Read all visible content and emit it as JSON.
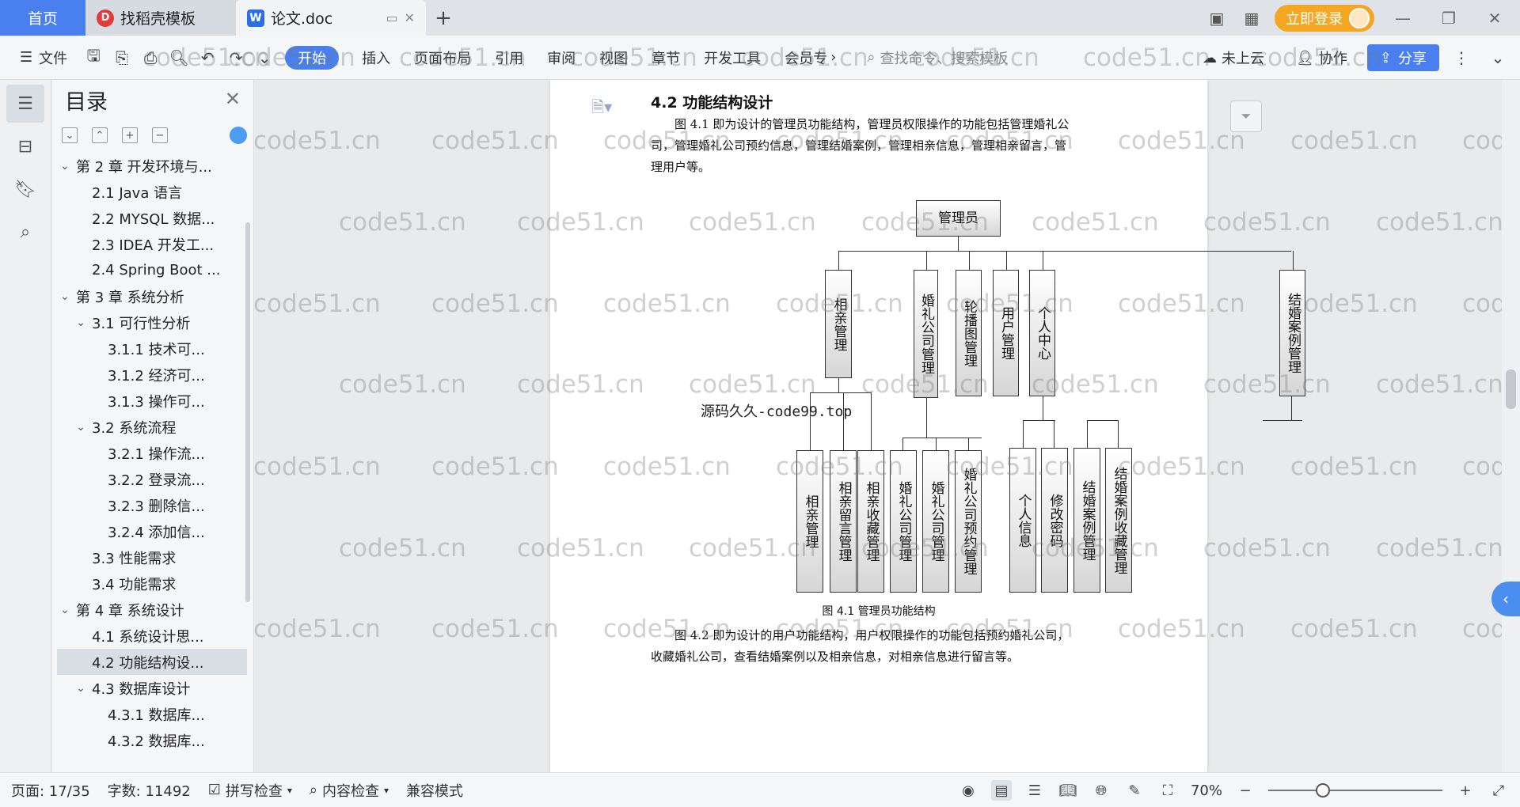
{
  "tabs": {
    "home_label": "首页",
    "template_tab": "找稻壳模板",
    "doc_tab": "论文.doc"
  },
  "topbar": {
    "login_label": "立即登录"
  },
  "ribbon": {
    "file_label": "文件",
    "start": "开始",
    "insert": "插入",
    "layout": "页面布局",
    "reference": "引用",
    "review": "审阅",
    "view": "视图",
    "chapter": "章节",
    "dev_tools": "开发工具",
    "member": "会员专",
    "search_placeholder": "查找命令、搜索模板",
    "cloud": "未上云",
    "collab": "协作",
    "share": "分享"
  },
  "toc": {
    "title": "目录",
    "items": [
      {
        "label": "第 2 章  开发环境与...",
        "level": 1,
        "expanded": true
      },
      {
        "label": "2.1 Java 语言",
        "level": 2
      },
      {
        "label": "2.2 MYSQL 数据...",
        "level": 2
      },
      {
        "label": "2.3 IDEA 开发工...",
        "level": 2
      },
      {
        "label": "2.4 Spring Boot ...",
        "level": 2
      },
      {
        "label": "第 3 章  系统分析",
        "level": 1,
        "expanded": true
      },
      {
        "label": "3.1  可行性分析",
        "level": 2,
        "expanded": true
      },
      {
        "label": "3.1.1  技术可...",
        "level": 3
      },
      {
        "label": "3.1.2  经济可...",
        "level": 3
      },
      {
        "label": "3.1.3  操作可...",
        "level": 3
      },
      {
        "label": "3.2  系统流程",
        "level": 2,
        "expanded": true
      },
      {
        "label": "3.2.1  操作流...",
        "level": 3
      },
      {
        "label": "3.2.2  登录流...",
        "level": 3
      },
      {
        "label": "3.2.3  删除信...",
        "level": 3
      },
      {
        "label": "3.2.4  添加信...",
        "level": 3
      },
      {
        "label": "3.3  性能需求",
        "level": 2
      },
      {
        "label": "3.4  功能需求",
        "level": 2
      },
      {
        "label": "第 4 章  系统设计",
        "level": 1,
        "expanded": true
      },
      {
        "label": "4.1  系统设计思...",
        "level": 2
      },
      {
        "label": "4.2  功能结构设...",
        "level": 2,
        "selected": true
      },
      {
        "label": "4.3  数据库设计",
        "level": 2,
        "expanded": true
      },
      {
        "label": "4.3.1  数据库...",
        "level": 3
      },
      {
        "label": "4.3.2  数据库...",
        "level": 3
      }
    ]
  },
  "document": {
    "heading": "4.2  功能结构设计",
    "para1_l1": "图 4.1 即为设计的管理员功能结构，管理员权限操作的功能包括管理婚礼公",
    "para1_l2": "司，管理婚礼公司预约信息，管理结婚案例，管理相亲信息，管理相亲留言，管",
    "para1_l3": "理用户等。",
    "caption": "图 4.1  管理员功能结构",
    "para2_l1": "图 4.2 即为设计的用户功能结构，用户权限操作的功能包括预约婚礼公司，",
    "para2_l2": "收藏婚礼公司，查看结婚案例以及相亲信息，对相亲信息进行留言等。",
    "source_mark": "源码久久-code99.top"
  },
  "diagram": {
    "root": "管理员",
    "level1": [
      "相亲管理",
      "婚礼公司管理",
      "轮播图管理",
      "用户管理",
      "个人中心",
      "结婚案例管理"
    ],
    "level2": [
      "相亲管理",
      "相亲留言管理",
      "相亲收藏管理",
      "婚礼公司管理",
      "婚礼公司管理",
      "婚礼公司预约管理",
      "个人信息",
      "修改密码",
      "结婚案例管理",
      "结婚案例收藏管理"
    ]
  },
  "watermark": "code51.cn",
  "status": {
    "page": "页面: 17/35",
    "words": "字数: 11492",
    "spell": "拼写检查",
    "content_check": "内容检查",
    "compat": "兼容模式",
    "zoom": "70%"
  },
  "colors": {
    "accent": "#4a7ff0",
    "login": "#f5a623"
  }
}
